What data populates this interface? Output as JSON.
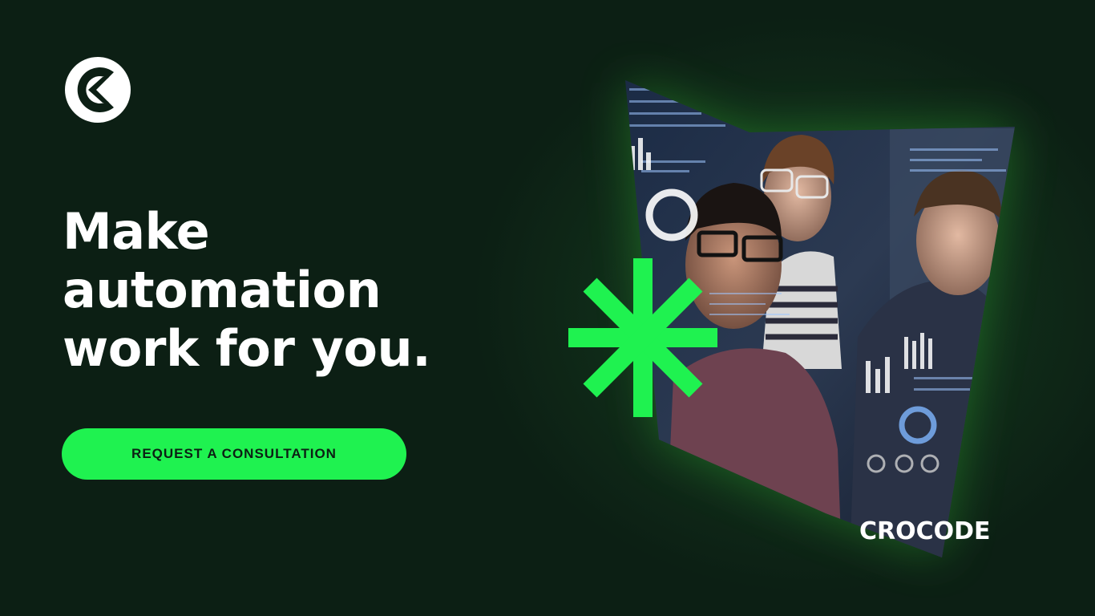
{
  "headline": {
    "line1": "Make",
    "line2": "automation",
    "line3": "work for you."
  },
  "cta": {
    "label": "REQUEST A CONSULTATION"
  },
  "brand": {
    "name": "CROCODE"
  },
  "colors": {
    "background": "#0c1f14",
    "accent": "#1ff250",
    "text": "#ffffff"
  },
  "icons": {
    "logo": "crocode-c-arrow-logo",
    "decoration": "asterisk-icon"
  }
}
